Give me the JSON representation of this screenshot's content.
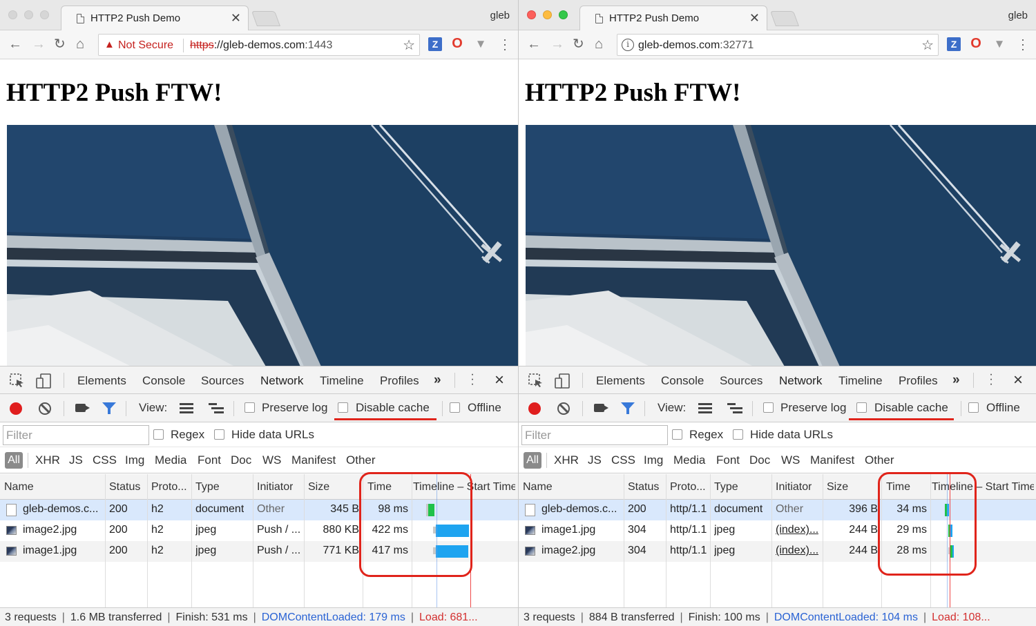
{
  "left": {
    "tab_title": "HTTP2 Push Demo",
    "profile": "gleb",
    "security_text": "Not Secure",
    "url_scheme": "https",
    "url_host": "://gleb-demos.com",
    "url_port": ":1443",
    "heading": "HTTP2 Push FTW!",
    "rows": [
      {
        "name": "gleb-demos.c...",
        "status": "200",
        "proto": "h2",
        "type": "document",
        "initiator": "Other",
        "size": "345 B",
        "time": "98 ms"
      },
      {
        "name": "image2.jpg",
        "status": "200",
        "proto": "h2",
        "type": "jpeg",
        "initiator": "Push / ...",
        "size": "880 KB",
        "time": "422 ms"
      },
      {
        "name": "image1.jpg",
        "status": "200",
        "proto": "h2",
        "type": "jpeg",
        "initiator": "Push / ...",
        "size": "771 KB",
        "time": "417 ms"
      }
    ],
    "status": {
      "requests": "3 requests",
      "transferred": "1.6 MB transferred",
      "finish": "Finish: 531 ms",
      "dcl": "DOMContentLoaded: 179 ms",
      "load": "Load: 681..."
    }
  },
  "right": {
    "tab_title": "HTTP2 Push Demo",
    "profile": "gleb",
    "url_host": "gleb-demos.com",
    "url_port": ":32771",
    "heading": "HTTP2 Push FTW!",
    "rows": [
      {
        "name": "gleb-demos.c...",
        "status": "200",
        "proto": "http/1.1",
        "type": "document",
        "initiator": "Other",
        "size": "396 B",
        "time": "34 ms"
      },
      {
        "name": "image1.jpg",
        "status": "304",
        "proto": "http/1.1",
        "type": "jpeg",
        "initiator": "(index)...",
        "size": "244 B",
        "time": "29 ms"
      },
      {
        "name": "image2.jpg",
        "status": "304",
        "proto": "http/1.1",
        "type": "jpeg",
        "initiator": "(index)...",
        "size": "244 B",
        "time": "28 ms"
      }
    ],
    "status": {
      "requests": "3 requests",
      "transferred": "884 B transferred",
      "finish": "Finish: 100 ms",
      "dcl": "DOMContentLoaded: 104 ms",
      "load": "Load: 108..."
    }
  },
  "devtools": {
    "tabs": [
      "Elements",
      "Console",
      "Sources",
      "Network",
      "Timeline",
      "Profiles"
    ],
    "more": "»",
    "view_label": "View:",
    "preserve_log": "Preserve log",
    "disable_cache": "Disable cache",
    "offline": "Offline",
    "filter_placeholder": "Filter",
    "regex": "Regex",
    "hide_data_urls": "Hide data URLs",
    "types": [
      "All",
      "XHR",
      "JS",
      "CSS",
      "Img",
      "Media",
      "Font",
      "Doc",
      "WS",
      "Manifest",
      "Other"
    ],
    "columns": {
      "name": "Name",
      "status": "Status",
      "proto": "Proto...",
      "type": "Type",
      "initiator": "Initiator",
      "size": "Size",
      "time": "Time",
      "timeline": "Timeline – Start Time"
    }
  },
  "colors": {
    "accent": "#3879d9",
    "highlight": "#e0241b",
    "waiting": "#1fc24a",
    "download": "#1ea4f0"
  }
}
